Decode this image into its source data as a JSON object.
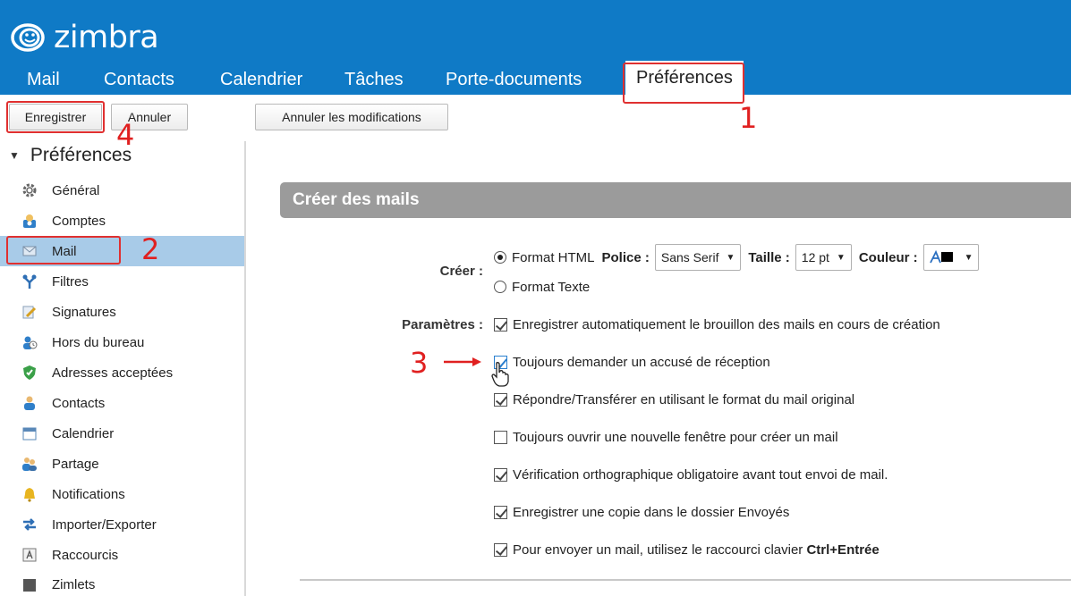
{
  "app": {
    "logo_text": "zimbra"
  },
  "tabs": [
    {
      "label": "Mail"
    },
    {
      "label": "Contacts"
    },
    {
      "label": "Calendrier"
    },
    {
      "label": "Tâches"
    },
    {
      "label": "Porte-documents"
    },
    {
      "label": "Préférences",
      "active": true
    }
  ],
  "toolbar": {
    "save_label": "Enregistrer",
    "cancel_label": "Annuler",
    "undo_changes_label": "Annuler les modifications"
  },
  "sidebar": {
    "root_label": "Préférences",
    "items": [
      {
        "label": "Général",
        "icon": "gear-icon"
      },
      {
        "label": "Comptes",
        "icon": "accounts-icon"
      },
      {
        "label": "Mail",
        "icon": "envelope-icon",
        "selected": true
      },
      {
        "label": "Filtres",
        "icon": "filter-icon"
      },
      {
        "label": "Signatures",
        "icon": "signature-icon"
      },
      {
        "label": "Hors du bureau",
        "icon": "out-of-office-icon"
      },
      {
        "label": "Adresses acceptées",
        "icon": "shield-icon"
      },
      {
        "label": "Contacts",
        "icon": "contact-icon"
      },
      {
        "label": "Calendrier",
        "icon": "calendar-icon"
      },
      {
        "label": "Partage",
        "icon": "sharing-icon"
      },
      {
        "label": "Notifications",
        "icon": "bell-icon"
      },
      {
        "label": "Importer/Exporter",
        "icon": "import-export-icon"
      },
      {
        "label": "Raccourcis",
        "icon": "shortcut-icon"
      },
      {
        "label": "Zimlets",
        "icon": "zimlet-icon"
      }
    ]
  },
  "section": {
    "title": "Créer des mails"
  },
  "compose": {
    "label": "Créer :",
    "format_html": "Format HTML",
    "format_text": "Format Texte",
    "selected_format": "Format HTML",
    "font_label": "Police :",
    "font_value": "Sans Serif",
    "size_label": "Taille :",
    "size_value": "12 pt",
    "color_label": "Couleur :",
    "color_value": "#000000"
  },
  "settings": {
    "label": "Paramètres :",
    "options": [
      {
        "text": "Enregistrer automatiquement le brouillon des mails en cours de création",
        "checked": true
      },
      {
        "text": "Toujours demander un accusé de réception",
        "checked": true
      },
      {
        "text": "Répondre/Transférer en utilisant le format du mail original",
        "checked": true
      },
      {
        "text": "Toujours ouvrir une nouvelle fenêtre pour créer un mail",
        "checked": false
      },
      {
        "text": "Vérification orthographique obligatoire avant tout envoi de mail.",
        "checked": true
      },
      {
        "text": "Enregistrer une copie dans le dossier Envoyés",
        "checked": true
      },
      {
        "text_prefix": "Pour envoyer un mail, utilisez le raccourci clavier ",
        "text_bold": "Ctrl+Entrée",
        "checked": true
      }
    ]
  },
  "annotations": {
    "step1": "1",
    "step2": "2",
    "step3": "3",
    "step4": "4",
    "accent_color": "#e02020"
  },
  "colors": {
    "header_bg": "#0f7ac6",
    "selected_item_bg": "#a8cbe8",
    "section_header_bg": "#9b9b9b"
  }
}
